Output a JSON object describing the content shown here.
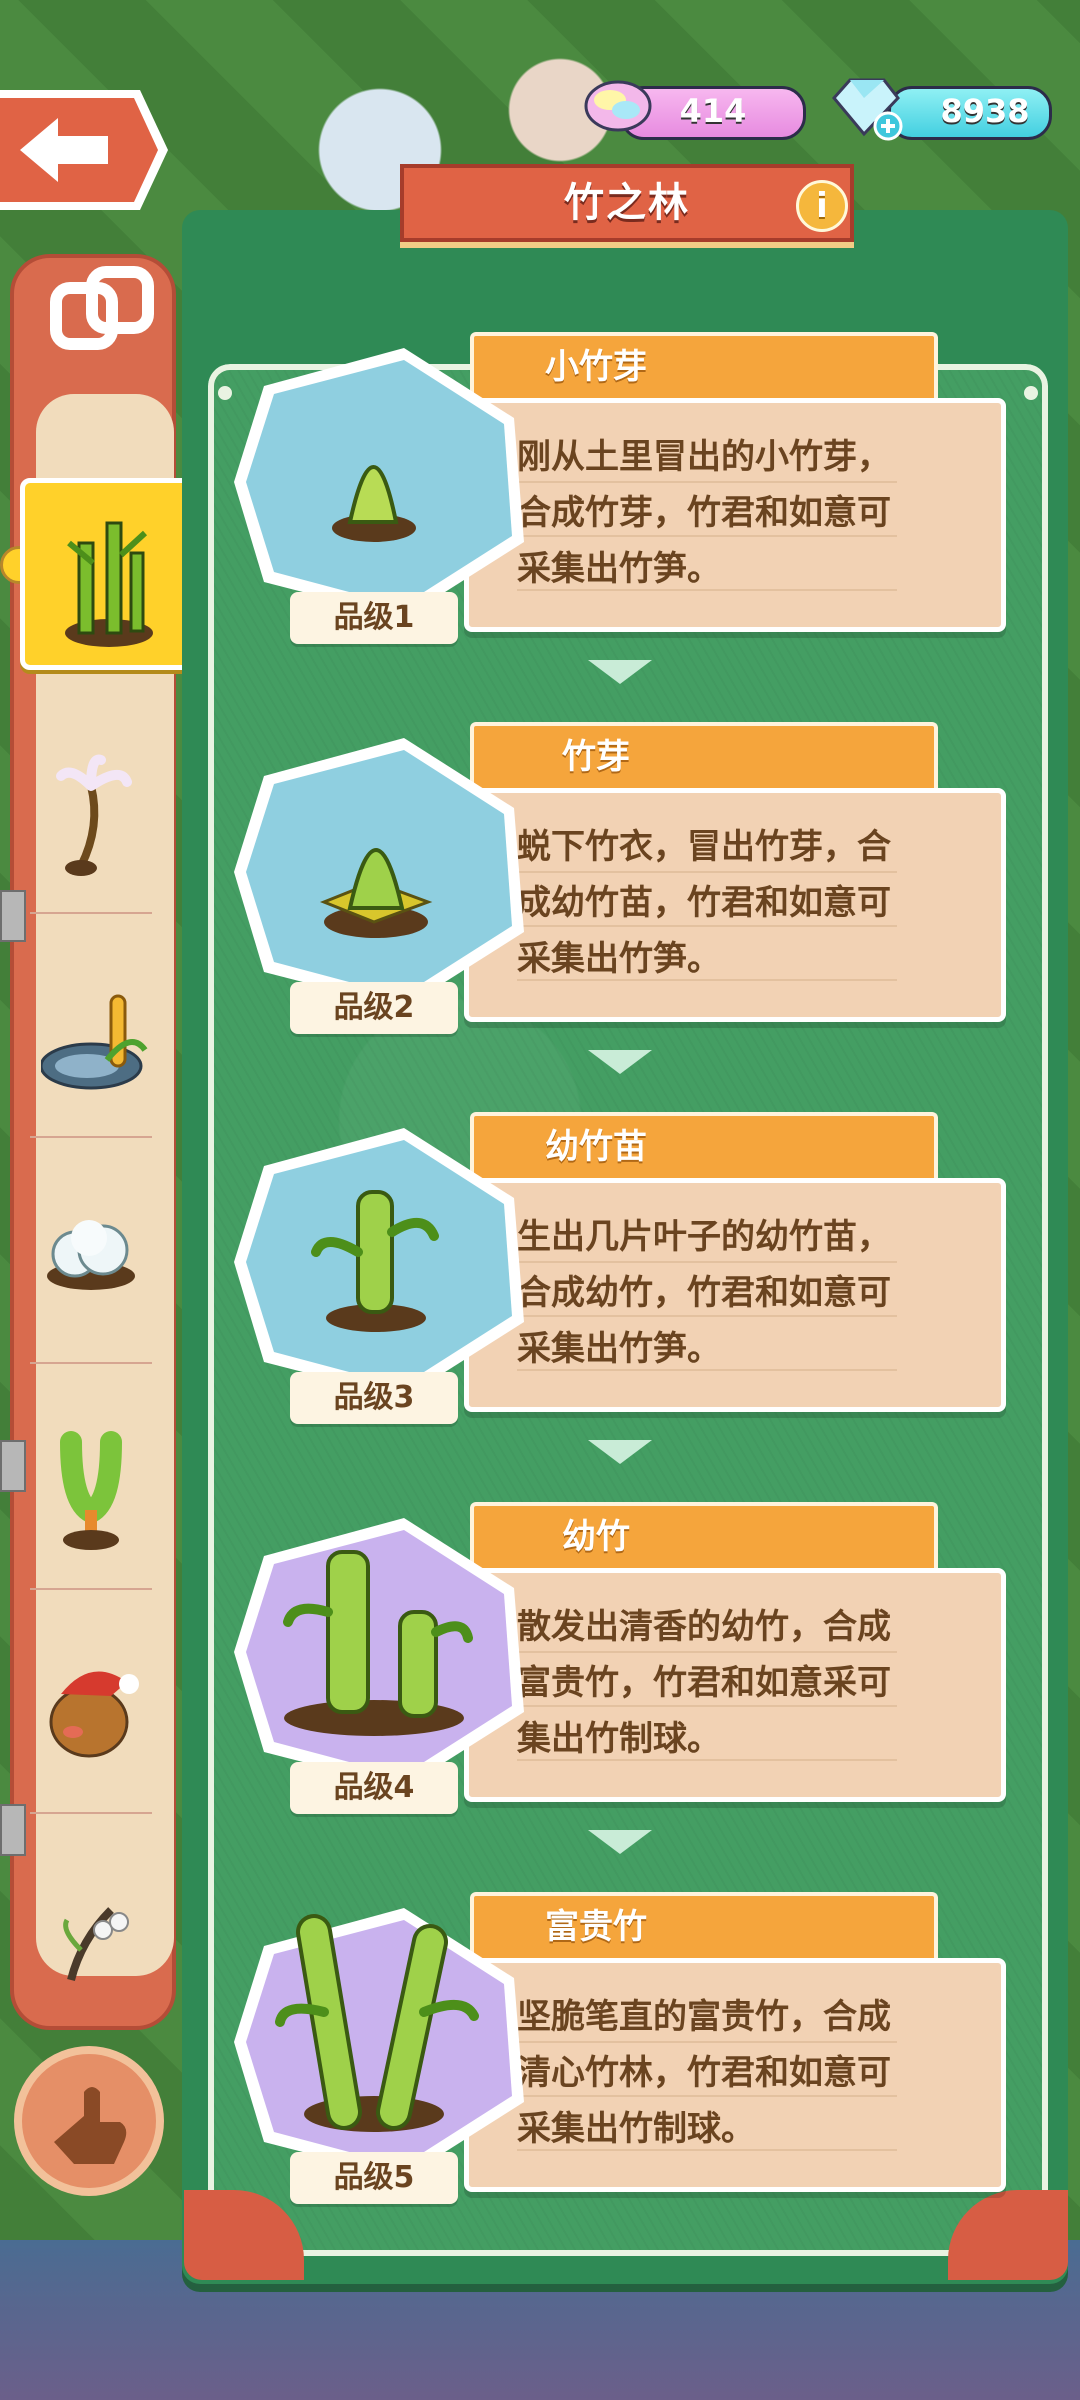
{
  "header": {
    "title": "竹之林",
    "info_label": "i"
  },
  "currency": {
    "candy": "414",
    "gems": "8938"
  },
  "sidebar": {
    "items": [
      {
        "name": "bamboo",
        "active": true
      },
      {
        "name": "dandelion",
        "active": false
      },
      {
        "name": "pond-corn",
        "active": false
      },
      {
        "name": "cotton",
        "active": false
      },
      {
        "name": "cactus-plant",
        "active": false
      },
      {
        "name": "potato-santa",
        "active": false
      },
      {
        "name": "cotton-branch",
        "active": false
      }
    ]
  },
  "cards": [
    {
      "name": "小竹芽",
      "desc": "刚从土里冒出的小竹芽，合成竹芽，竹君和如意可采集出竹笋。",
      "grade": "品级1",
      "bg": "#8fcfe0"
    },
    {
      "name": "竹芽",
      "desc": "蜕下竹衣，冒出竹芽，合成幼竹苗，竹君和如意可采集出竹笋。",
      "grade": "品级2",
      "bg": "#8fcfe0"
    },
    {
      "name": "幼竹苗",
      "desc": "生出几片叶子的幼竹苗，合成幼竹，竹君和如意可采集出竹笋。",
      "grade": "品级3",
      "bg": "#8fcfe0"
    },
    {
      "name": "幼竹",
      "desc": "散发出清香的幼竹，合成富贵竹，竹君和如意采可集出竹制球。",
      "grade": "品级4",
      "bg": "#c9b2ee"
    },
    {
      "name": "富贵竹",
      "desc": "坚脆笔直的富贵竹，合成清心竹林，竹君和如意可采集出竹制球。",
      "grade": "品级5",
      "bg": "#c9b2ee"
    }
  ]
}
